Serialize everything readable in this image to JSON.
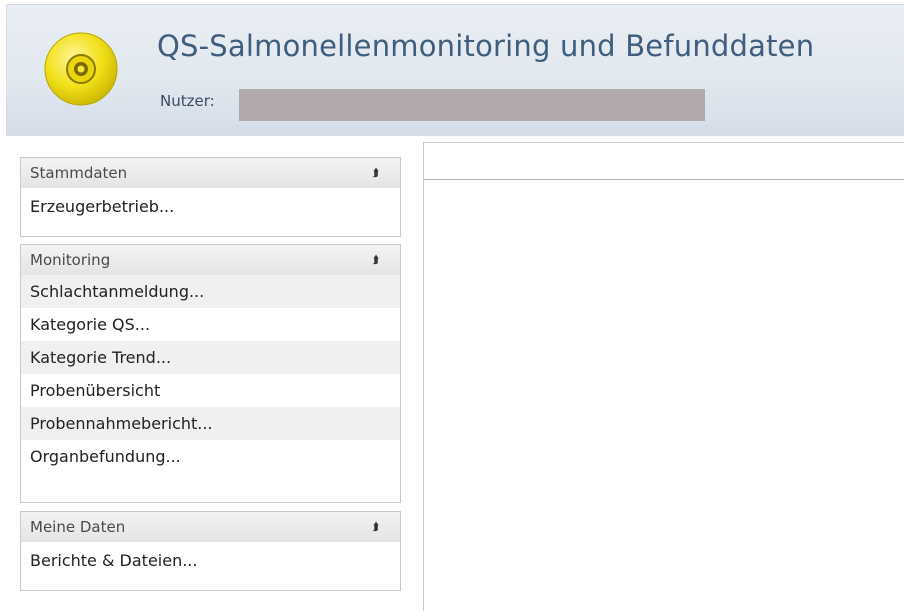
{
  "header": {
    "title": "QS-Salmonellenmonitoring und Befunddaten",
    "user_label": "Nutzer:"
  },
  "sidebar": {
    "panels": [
      {
        "title": "Stammdaten",
        "items": [
          "Erzeugerbetrieb..."
        ]
      },
      {
        "title": "Monitoring",
        "items": [
          "Schlachtanmeldung...",
          "Kategorie QS...",
          "Kategorie Trend...",
          "Probenübersicht",
          "Probennahmebericht...",
          "Organbefundung..."
        ]
      },
      {
        "title": "Meine Daten",
        "items": [
          "Berichte & Dateien..."
        ]
      }
    ],
    "collapse_icon": "double-chevron-up-icon"
  },
  "colors": {
    "header_title": "#3f5d7d",
    "logo_yellow": "#f2e11a",
    "redaction": "#b1a9aa"
  }
}
